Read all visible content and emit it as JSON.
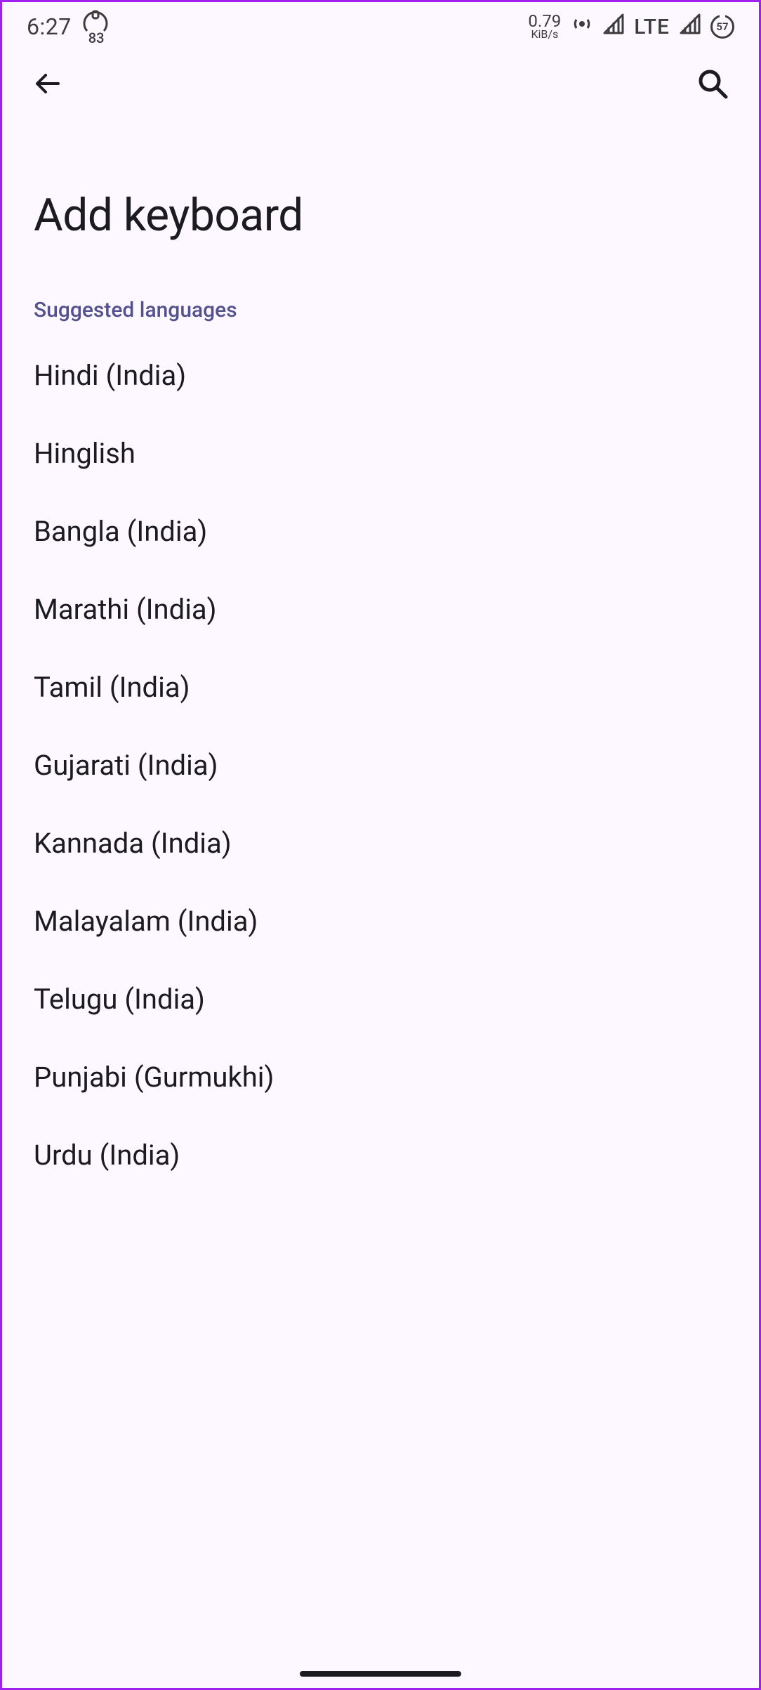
{
  "status": {
    "time": "6:27",
    "lock_badge": "83",
    "data_rate_value": "0.79",
    "data_rate_unit": "KiB/s",
    "network_type": "LTE",
    "battery": "57"
  },
  "header": {
    "title": "Add keyboard"
  },
  "section": {
    "label": "Suggested languages"
  },
  "languages": [
    "Hindi (India)",
    "Hinglish",
    "Bangla (India)",
    "Marathi (India)",
    "Tamil (India)",
    "Gujarati (India)",
    "Kannada (India)",
    "Malayalam (India)",
    "Telugu (India)",
    "Punjabi (Gurmukhi)",
    "Urdu (India)"
  ]
}
